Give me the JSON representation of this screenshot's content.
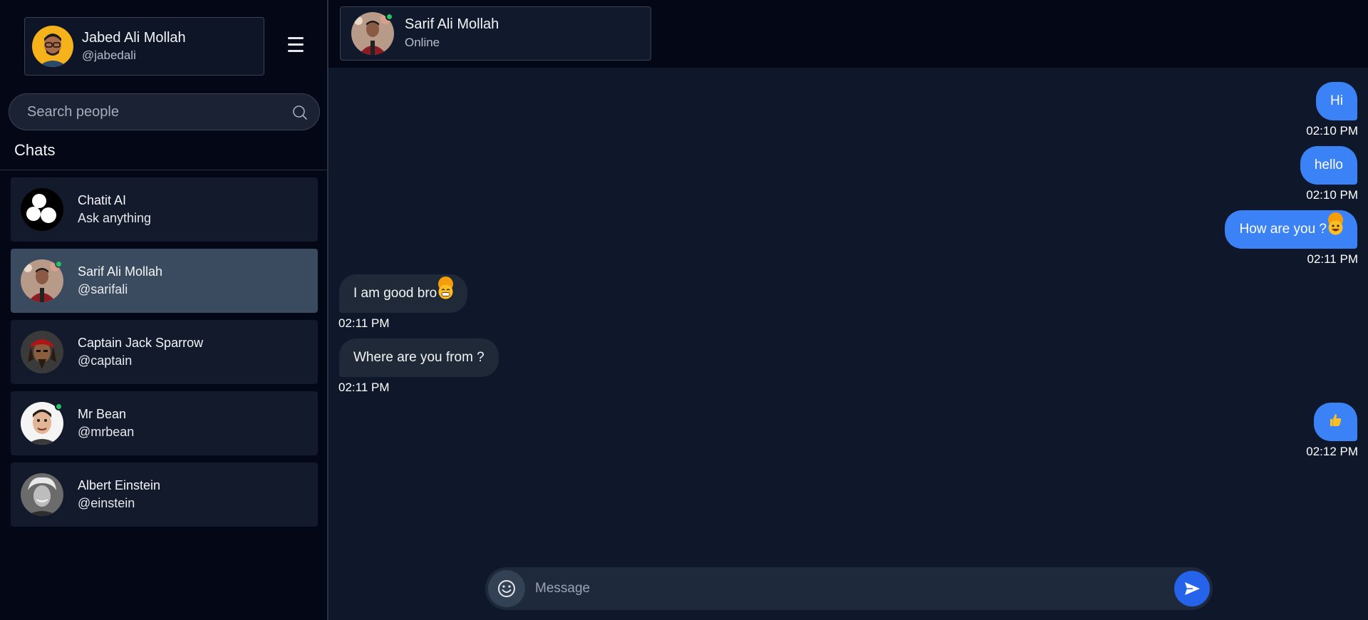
{
  "user": {
    "name": "Jabed Ali Mollah",
    "handle": "@jabedali"
  },
  "search": {
    "placeholder": "Search people"
  },
  "sidebar": {
    "title": "Chats",
    "chats": [
      {
        "name": "Chatit AI",
        "sub": "Ask anything",
        "online": false,
        "active": false
      },
      {
        "name": "Sarif Ali Mollah",
        "sub": "@sarifali",
        "online": true,
        "active": true
      },
      {
        "name": "Captain Jack Sparrow",
        "sub": "@captain",
        "online": false,
        "active": false
      },
      {
        "name": "Mr Bean",
        "sub": "@mrbean",
        "online": true,
        "active": false
      },
      {
        "name": "Albert Einstein",
        "sub": "@einstein",
        "online": false,
        "active": false
      }
    ]
  },
  "contact": {
    "name": "Sarif Ali Mollah",
    "status": "Online"
  },
  "messages": [
    {
      "dir": "out",
      "text": "Hi",
      "time": "02:10 PM"
    },
    {
      "dir": "out",
      "text": "hello",
      "time": "02:10 PM"
    },
    {
      "dir": "out",
      "text": "How are you ?",
      "emoji": "grinning-face",
      "time": "02:11 PM"
    },
    {
      "dir": "in",
      "text": "I am good bro",
      "emoji": "grin-face",
      "time": "02:11 PM"
    },
    {
      "dir": "in",
      "text": "Where are you from ?",
      "time": "02:11 PM"
    },
    {
      "dir": "out",
      "text": "",
      "emoji": "thumbs-up",
      "time": "02:12 PM"
    }
  ],
  "composer": {
    "placeholder": "Message"
  },
  "colors": {
    "accent": "#3b82f6",
    "online": "#22c55e",
    "background": "#0f172a",
    "sidebar": "#040816"
  }
}
